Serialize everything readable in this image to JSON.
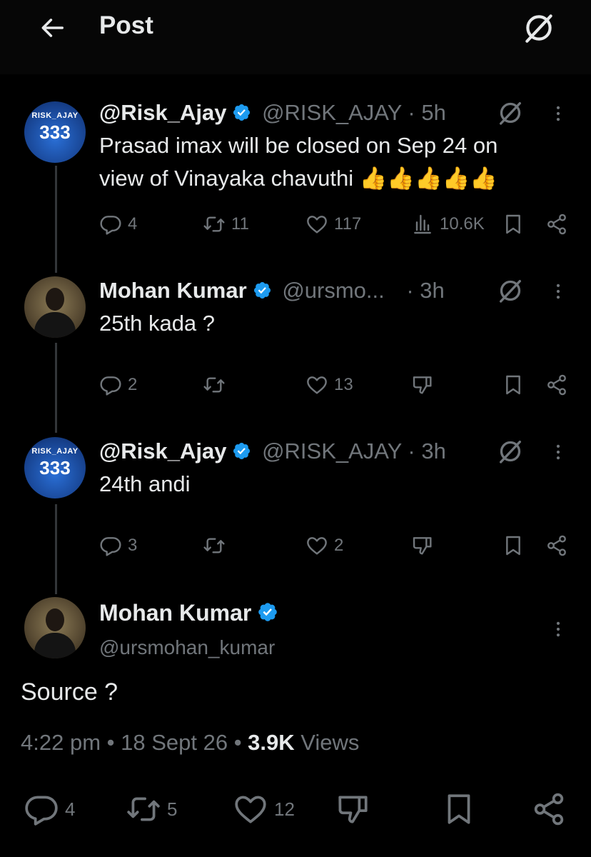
{
  "header": {
    "title": "Post",
    "back_icon": "arrow-left-icon",
    "grok_icon": "grok-icon"
  },
  "tweets": [
    {
      "name": "@Risk_Ajay",
      "handle": "@RISK_AJAY",
      "time": "· 5h",
      "avatar_text_1": "RISK_AJAY",
      "avatar_text_2": "333",
      "text_line_1": "Prasad imax will be closed on Sep 24 on",
      "text_line_2": "view of Vinayaka chavuthi 👍👍👍👍👍",
      "replies": "4",
      "reposts": "11",
      "likes": "117",
      "views": "10.6K"
    },
    {
      "name": "Mohan Kumar",
      "handle": "@ursmo...",
      "time": "· 3h",
      "text": "25th kada ?",
      "replies": "2",
      "reposts": "",
      "likes": "13"
    },
    {
      "name": "@Risk_Ajay",
      "handle": "@RISK_AJAY",
      "time": "· 3h",
      "avatar_text_1": "RISK_AJAY",
      "avatar_text_2": "333",
      "text": "24th andi",
      "replies": "3",
      "reposts": "",
      "likes": "2"
    }
  ],
  "main": {
    "name": "Mohan Kumar",
    "handle": "@ursmohan_kumar",
    "text": "Source ?",
    "time": "4:22 pm",
    "date": "18 Sept 26",
    "views_count": "3.9K",
    "views_label": "Views",
    "replies": "4",
    "reposts": "5",
    "likes": "12"
  },
  "colors": {
    "background": "#000000",
    "text": "#e7e9ea",
    "muted": "#71767b",
    "verified": "#1d9bf0"
  }
}
